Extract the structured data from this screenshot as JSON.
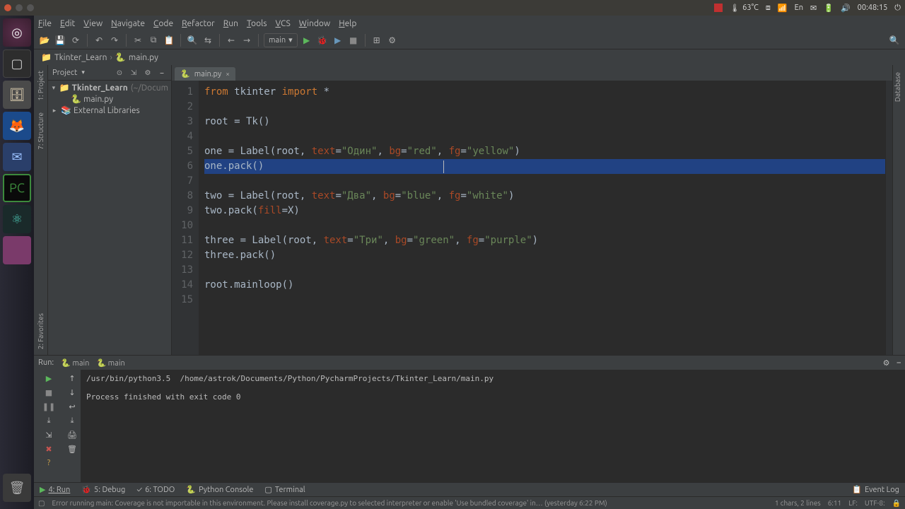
{
  "os_panel": {
    "temp": "63°C",
    "lang": "En",
    "time": "00:48:15"
  },
  "menu": [
    "File",
    "Edit",
    "View",
    "Navigate",
    "Code",
    "Refactor",
    "Run",
    "Tools",
    "VCS",
    "Window",
    "Help"
  ],
  "run_config_selected": "main",
  "breadcrumb": {
    "project": "Tkinter_Learn",
    "file": "main.py"
  },
  "project_panel": {
    "title": "Project",
    "root": "Tkinter_Learn",
    "root_path": "(~/Docum",
    "file": "main.py",
    "ext_libs": "External Libraries"
  },
  "editor": {
    "tab": "main.py",
    "lines": [
      {
        "n": 1,
        "tokens": [
          {
            "t": "from ",
            "c": "kw"
          },
          {
            "t": "tkinter ",
            "c": ""
          },
          {
            "t": "import ",
            "c": "kw"
          },
          {
            "t": "*",
            "c": ""
          }
        ]
      },
      {
        "n": 2,
        "tokens": []
      },
      {
        "n": 3,
        "tokens": [
          {
            "t": "root = Tk()",
            "c": ""
          }
        ]
      },
      {
        "n": 4,
        "tokens": []
      },
      {
        "n": 5,
        "tokens": [
          {
            "t": "one = Label(root, ",
            "c": ""
          },
          {
            "t": "text",
            "c": "named"
          },
          {
            "t": "=",
            "c": ""
          },
          {
            "t": "\"Один\"",
            "c": "str"
          },
          {
            "t": ", ",
            "c": ""
          },
          {
            "t": "bg",
            "c": "named"
          },
          {
            "t": "=",
            "c": ""
          },
          {
            "t": "\"red\"",
            "c": "str"
          },
          {
            "t": ", ",
            "c": ""
          },
          {
            "t": "fg",
            "c": "named"
          },
          {
            "t": "=",
            "c": ""
          },
          {
            "t": "\"yellow\"",
            "c": "str"
          },
          {
            "t": ")",
            "c": ""
          }
        ]
      },
      {
        "n": 6,
        "sel": true,
        "tokens": [
          {
            "t": "one.pack()",
            "c": ""
          }
        ]
      },
      {
        "n": 7,
        "tokens": []
      },
      {
        "n": 8,
        "tokens": [
          {
            "t": "two = Label(root, ",
            "c": ""
          },
          {
            "t": "text",
            "c": "named"
          },
          {
            "t": "=",
            "c": ""
          },
          {
            "t": "\"Два\"",
            "c": "str"
          },
          {
            "t": ", ",
            "c": ""
          },
          {
            "t": "bg",
            "c": "named"
          },
          {
            "t": "=",
            "c": ""
          },
          {
            "t": "\"blue\"",
            "c": "str"
          },
          {
            "t": ", ",
            "c": ""
          },
          {
            "t": "fg",
            "c": "named"
          },
          {
            "t": "=",
            "c": ""
          },
          {
            "t": "\"white\"",
            "c": "str"
          },
          {
            "t": ")",
            "c": ""
          }
        ]
      },
      {
        "n": 9,
        "tokens": [
          {
            "t": "two.pack(",
            "c": ""
          },
          {
            "t": "fill",
            "c": "named"
          },
          {
            "t": "=X)",
            "c": ""
          }
        ]
      },
      {
        "n": 10,
        "tokens": []
      },
      {
        "n": 11,
        "tokens": [
          {
            "t": "three = Label(root, ",
            "c": ""
          },
          {
            "t": "text",
            "c": "named"
          },
          {
            "t": "=",
            "c": ""
          },
          {
            "t": "\"Три\"",
            "c": "str"
          },
          {
            "t": ", ",
            "c": ""
          },
          {
            "t": "bg",
            "c": "named"
          },
          {
            "t": "=",
            "c": ""
          },
          {
            "t": "\"green\"",
            "c": "str"
          },
          {
            "t": ", ",
            "c": ""
          },
          {
            "t": "fg",
            "c": "named"
          },
          {
            "t": "=",
            "c": ""
          },
          {
            "t": "\"purple\"",
            "c": "str"
          },
          {
            "t": ")",
            "c": ""
          }
        ]
      },
      {
        "n": 12,
        "tokens": [
          {
            "t": "three.pack()",
            "c": ""
          }
        ]
      },
      {
        "n": 13,
        "tokens": []
      },
      {
        "n": 14,
        "tokens": [
          {
            "t": "root.mainloop()",
            "c": ""
          }
        ]
      },
      {
        "n": 15,
        "tokens": []
      }
    ]
  },
  "run_panel": {
    "label": "Run:",
    "configs": [
      "main",
      "main"
    ],
    "cmd": "/usr/bin/python3.5  /home/astrok/Documents/Python/PycharmProjects/Tkinter_Learn/main.py",
    "result": "Process finished with exit code 0"
  },
  "bottom_tabs": {
    "run": "4: Run",
    "debug": "5: Debug",
    "todo": "6: TODO",
    "pyconsole": "Python Console",
    "terminal": "Terminal",
    "eventlog": "Event Log"
  },
  "status": {
    "msg": "Error running main: Coverage is not importable in this environment. Please install coverage.py to selected interpreter or enable 'Use bundled coverage' in… (yesterday 6:22 PM)",
    "sel": "1 chars, 2 lines",
    "pos": "6:11",
    "lf": "LF:",
    "enc": "UTF-8:"
  }
}
